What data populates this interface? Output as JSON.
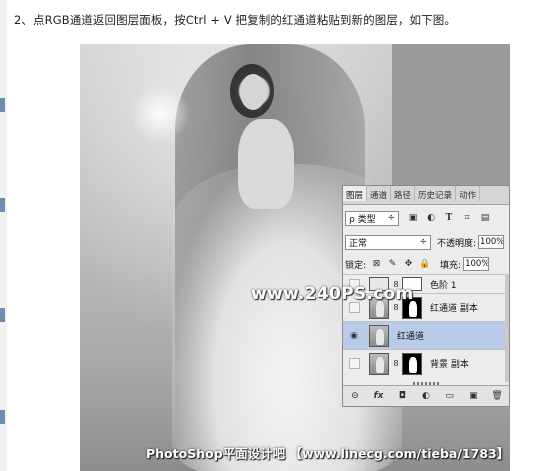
{
  "instruction": "2、点RGB通道返回图层面板，按Ctrl + V 把复制的红通道粘贴到新的图层，如下图。",
  "watermarks": {
    "site": "www.240PS.com",
    "footer": "PhotoShop平面设计吧 【www.linecg.com/tieba/1783】"
  },
  "panel": {
    "tabs": [
      "图层",
      "通道",
      "路径",
      "历史记录",
      "动作"
    ],
    "filter": {
      "label": "ρ 类型",
      "arrow": "÷",
      "icons": [
        "image-filter-icon",
        "adjustment-filter-icon",
        "type-filter-icon",
        "shape-filter-icon",
        "smart-object-filter-icon"
      ]
    },
    "blend_mode": "正常",
    "opacity_label": "不透明度:",
    "opacity_value": "100%",
    "lock_label": "锁定:",
    "fill_label": "填充:",
    "fill_value": "100%",
    "layers": [
      {
        "name": "色阶 1",
        "visible": false,
        "selected": false
      },
      {
        "name": "红通道 副本",
        "visible": false,
        "selected": false
      },
      {
        "name": "红通道",
        "visible": true,
        "selected": true
      },
      {
        "name": "背景 副本",
        "visible": false,
        "selected": false
      }
    ],
    "footer_icons": [
      "link-icon",
      "fx-icon",
      "add-mask-icon",
      "adjustment-icon",
      "group-folder-icon",
      "new-layer-icon",
      "trash-icon"
    ],
    "footer_glyphs": [
      "⊝",
      "fx",
      "◘",
      "◐",
      "▭",
      "▣",
      "🗑"
    ]
  }
}
